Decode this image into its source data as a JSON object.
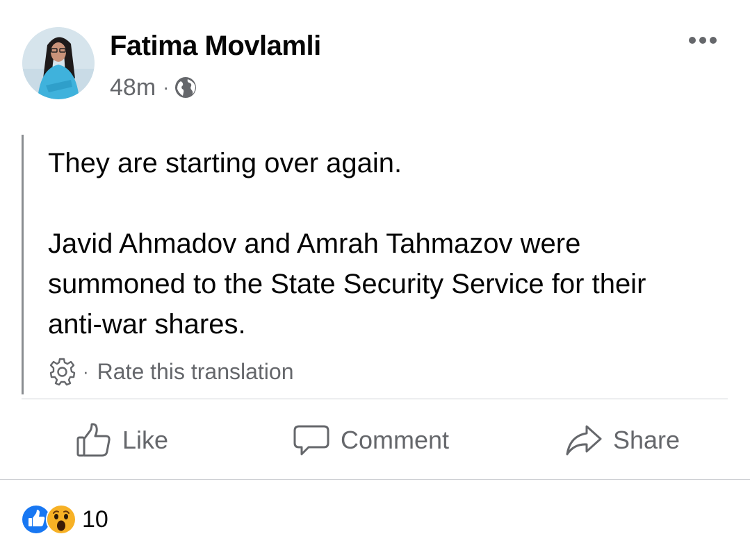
{
  "post": {
    "author_name": "Fatima Movlamli",
    "time_ago": "48m",
    "separator": "·",
    "privacy_icon": "globe-icon",
    "more_icon": "more-horizontal-icon",
    "paragraphs": [
      "They are starting over again.",
      "Javid Ahmadov and Amrah Tahmazov were summoned to the State Security Service for their anti-war shares."
    ]
  },
  "translation": {
    "settings_icon": "gear-icon",
    "separator": "·",
    "rate_label": "Rate this translation"
  },
  "actions": {
    "like_label": "Like",
    "comment_label": "Comment",
    "share_label": "Share"
  },
  "reactions": {
    "icons": [
      "like-reaction-icon",
      "wow-reaction-icon"
    ],
    "count": "10"
  },
  "colors": {
    "text_primary": "#050505",
    "text_secondary": "#65676b",
    "like_blue": "#1877f2",
    "wow_yellow": "#f7b125",
    "divider": "#ced0d4"
  }
}
